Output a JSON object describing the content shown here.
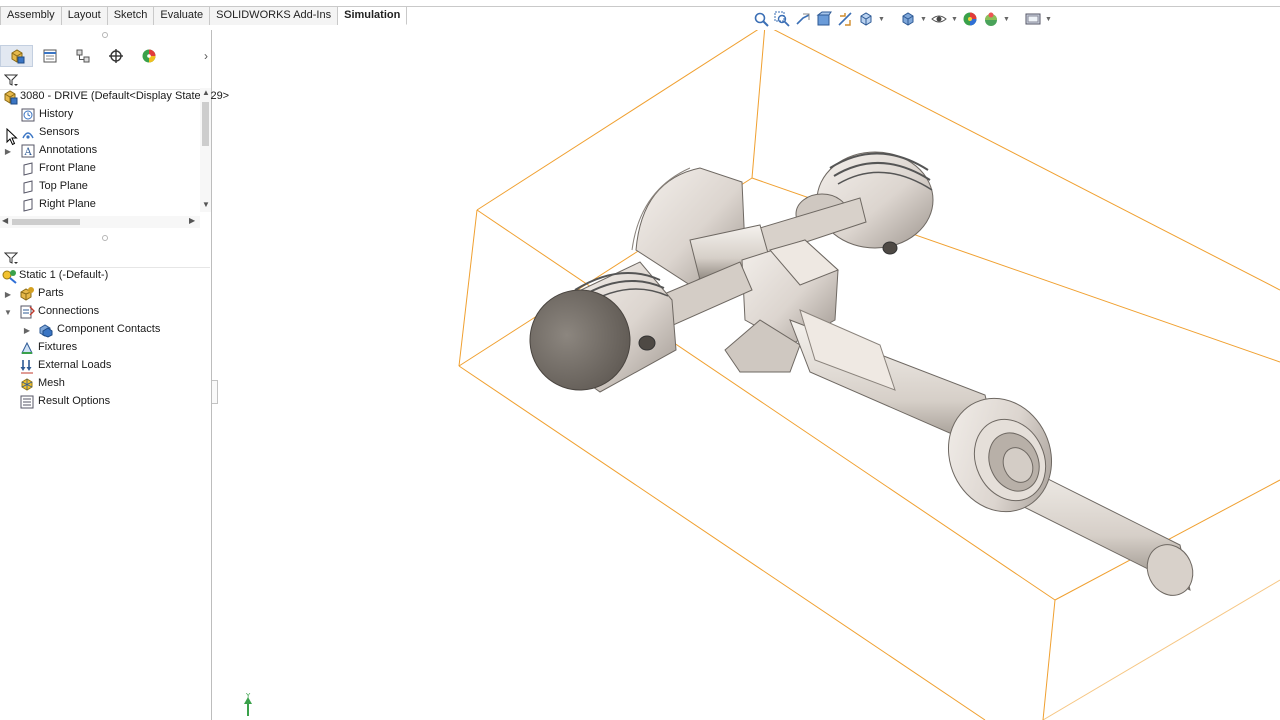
{
  "command_tabs": [
    {
      "label": "Assembly",
      "active": false
    },
    {
      "label": "Layout",
      "active": false
    },
    {
      "label": "Sketch",
      "active": false
    },
    {
      "label": "Evaluate",
      "active": false
    },
    {
      "label": "SOLIDWORKS Add-Ins",
      "active": false
    },
    {
      "label": "Simulation",
      "active": true
    }
  ],
  "heads_up_toolbar": [
    "zoom-to-fit-icon",
    "zoom-to-area-icon",
    "previous-view-icon",
    "section-view-icon",
    "dynamic-annotation-icon",
    "view-orientation-icon",
    "display-style-icon",
    "hide-show-items-icon",
    "edit-appearance-icon",
    "apply-scene-icon",
    "view-settings-icon"
  ],
  "manager_tabs": [
    "featuremanager-icon",
    "propertymanager-icon",
    "configurationmanager-icon",
    "dimxpertmanager-icon",
    "displaymanager-icon"
  ],
  "feature_tree": {
    "root_label": "3080 - DRIVE  (Default<Display State-129>",
    "items": [
      {
        "label": "History",
        "icon": "history-icon",
        "expandable": false
      },
      {
        "label": "Sensors",
        "icon": "sensors-icon",
        "expandable": false
      },
      {
        "label": "Annotations",
        "icon": "annotations-icon",
        "expandable": true
      },
      {
        "label": "Front Plane",
        "icon": "plane-icon",
        "expandable": false
      },
      {
        "label": "Top Plane",
        "icon": "plane-icon",
        "expandable": false
      },
      {
        "label": "Right Plane",
        "icon": "plane-icon",
        "expandable": false
      }
    ]
  },
  "simulation_tree": {
    "root_label": "Static 1 (-Default-)",
    "items": [
      {
        "label": "Parts",
        "icon": "parts-icon",
        "expand": "collapsed",
        "level": 1
      },
      {
        "label": "Connections",
        "icon": "connections-icon",
        "expand": "expanded",
        "level": 1
      },
      {
        "label": "Component Contacts",
        "icon": "component-contacts-icon",
        "expand": "collapsed",
        "level": 2
      },
      {
        "label": "Fixtures",
        "icon": "fixtures-icon",
        "expand": "none",
        "level": 1
      },
      {
        "label": "External Loads",
        "icon": "external-loads-icon",
        "expand": "none",
        "level": 1
      },
      {
        "label": "Mesh",
        "icon": "mesh-icon",
        "expand": "none",
        "level": 1
      },
      {
        "label": "Result Options",
        "icon": "result-options-icon",
        "expand": "none",
        "level": 1
      }
    ]
  },
  "colors": {
    "bounding_box": "#f0a030",
    "part_fill": "#e8e2dc",
    "part_shadow": "#a9a19a",
    "part_dark": "#6e6862"
  }
}
